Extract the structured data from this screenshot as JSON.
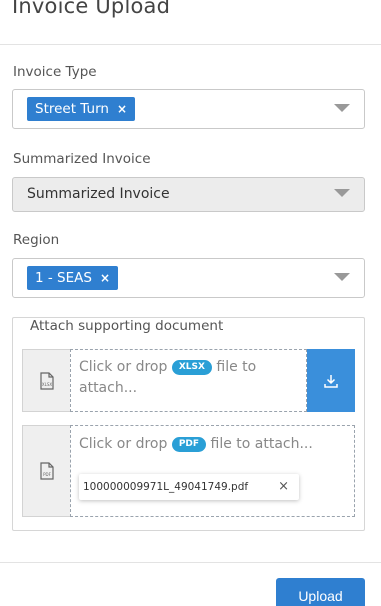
{
  "header": {
    "title": "Invoice Upload"
  },
  "invoice_type": {
    "label": "Invoice Type",
    "selected_tag": "Street Turn",
    "remove": "×"
  },
  "summarized_invoice": {
    "label": "Summarized Invoice",
    "value": "Summarized Invoice"
  },
  "region": {
    "label": "Region",
    "selected_tag": "1 - SEAS",
    "remove": "×"
  },
  "attach": {
    "legend": "Attach supporting document",
    "xlsx_drop": {
      "prefix": "Click or drop",
      "badge": "XLSX",
      "suffix": "file to attach...",
      "icon_label": "XLSX"
    },
    "pdf_drop": {
      "prefix": "Click or drop",
      "badge": "PDF",
      "suffix": "file to attach...",
      "icon_label": "PDF",
      "file_name": "100000009971L_49041749.pdf",
      "remove": "×"
    }
  },
  "footer": {
    "upload_label": "Upload"
  },
  "colors": {
    "accent": "#2f7fd0",
    "badge": "#2a9fd6"
  }
}
